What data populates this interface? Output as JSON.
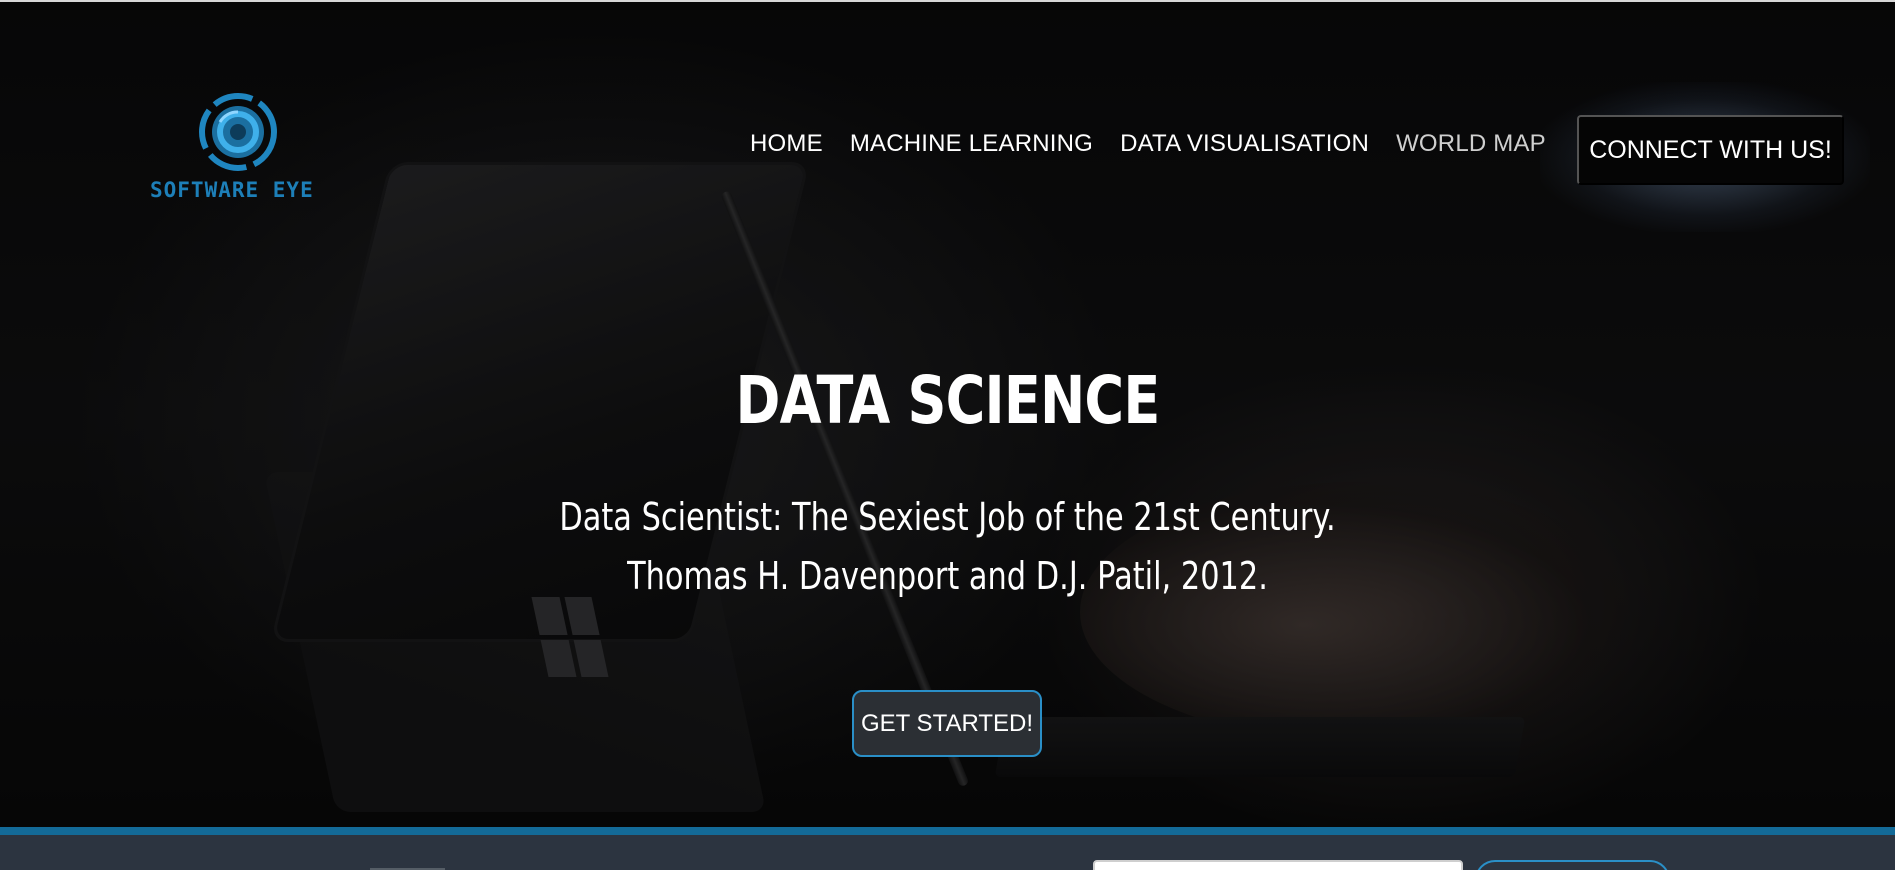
{
  "brand": {
    "name": "SOFTWARE EYE",
    "color": "#1d7fb8"
  },
  "nav": {
    "items": [
      {
        "label": "HOME"
      },
      {
        "label": "MACHINE LEARNING"
      },
      {
        "label": "DATA VISUALISATION"
      },
      {
        "label": "WORLD MAP"
      }
    ],
    "connect_label": "CONNECT WITH US!"
  },
  "hero": {
    "title": "DATA SCIENCE",
    "quote_line1": "Data Scientist: The Sexiest Job of the 21st Century.",
    "quote_line2": "Thomas H. Davenport and D.J. Patil, 2012.",
    "cta_label": "GET STARTED!"
  },
  "colors": {
    "accent": "#2a8fc7",
    "band": "#136a98",
    "footer": "#2c3440"
  }
}
